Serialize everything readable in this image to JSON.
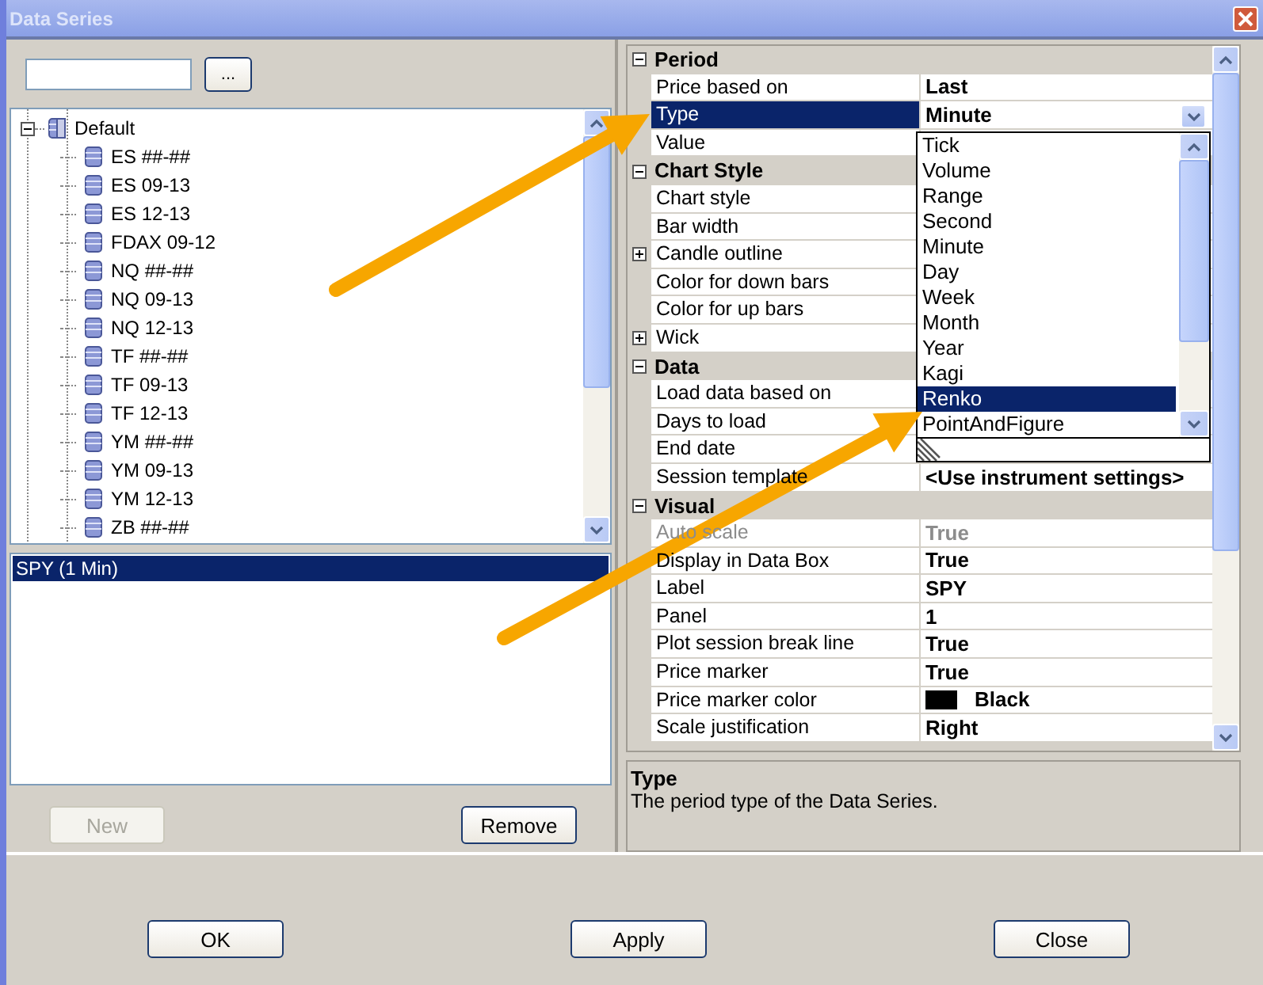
{
  "window": {
    "title": "Data Series"
  },
  "browse_button": "...",
  "tree": {
    "label": "Default",
    "expanded": true,
    "children": [
      {
        "label": "ES ##-##"
      },
      {
        "label": "ES 09-13"
      },
      {
        "label": "ES 12-13"
      },
      {
        "label": "FDAX 09-12"
      },
      {
        "label": "NQ ##-##"
      },
      {
        "label": "NQ 09-13"
      },
      {
        "label": "NQ 12-13"
      },
      {
        "label": "TF ##-##"
      },
      {
        "label": "TF 09-13"
      },
      {
        "label": "TF 12-13"
      },
      {
        "label": "YM ##-##"
      },
      {
        "label": "YM 09-13"
      },
      {
        "label": "YM 12-13"
      },
      {
        "label": "ZB ##-##"
      }
    ]
  },
  "series_list": [
    {
      "label": "SPY (1 Min)",
      "selected": true
    }
  ],
  "list_buttons": [
    {
      "label": "New",
      "disabled": true
    },
    {
      "label": "Remove",
      "disabled": false
    }
  ],
  "properties": [
    {
      "category": "Period",
      "expanded": true,
      "rows": [
        {
          "name": "Price based on",
          "value": "Last",
          "selected": false
        },
        {
          "name": "Type",
          "value": "Minute",
          "selected": true,
          "kind": "combo"
        },
        {
          "name": "Value",
          "selected": false
        }
      ]
    },
    {
      "category": "Chart Style",
      "expanded": true,
      "rows": [
        {
          "name": "Chart style",
          "selected": false
        },
        {
          "name": "Bar width",
          "selected": false
        },
        {
          "name": "Candle outline",
          "selected": false,
          "expanded": false
        },
        {
          "name": "Color for down bars",
          "selected": false
        },
        {
          "name": "Color for up bars",
          "selected": false
        },
        {
          "name": "Wick",
          "selected": false,
          "expanded": false
        }
      ]
    },
    {
      "category": "Data",
      "expanded": true,
      "rows": [
        {
          "name": "Load data based on",
          "selected": false
        },
        {
          "name": "Days to load",
          "selected": false
        },
        {
          "name": "End date",
          "selected": false
        },
        {
          "name": "Session template",
          "value": "<Use instrument settings>",
          "selected": false
        }
      ]
    },
    {
      "category": "Visual",
      "expanded": true,
      "rows": [
        {
          "name": "Auto scale",
          "value": "True",
          "selected": false,
          "disabled": true
        },
        {
          "name": "Display in Data Box",
          "value": "True",
          "selected": false
        },
        {
          "name": "Label",
          "value": "SPY",
          "selected": false
        },
        {
          "name": "Panel",
          "value": "1",
          "selected": false
        },
        {
          "name": "Plot session break line",
          "value": "True",
          "selected": false
        },
        {
          "name": "Price marker",
          "value": "True",
          "selected": false
        },
        {
          "name": "Price marker color",
          "value": "Black",
          "selected": false,
          "color": "#000000"
        },
        {
          "name": "Scale justification",
          "value": "Right",
          "selected": false
        }
      ]
    }
  ],
  "dropdown": {
    "items": [
      {
        "label": "Tick",
        "selected": false
      },
      {
        "label": "Volume",
        "selected": false
      },
      {
        "label": "Range",
        "selected": false
      },
      {
        "label": "Second",
        "selected": false
      },
      {
        "label": "Minute",
        "selected": false
      },
      {
        "label": "Day",
        "selected": false
      },
      {
        "label": "Week",
        "selected": false
      },
      {
        "label": "Month",
        "selected": false
      },
      {
        "label": "Year",
        "selected": false
      },
      {
        "label": "Kagi",
        "selected": false
      },
      {
        "label": "Renko",
        "selected": true
      },
      {
        "label": "PointAndFigure",
        "selected": false
      }
    ]
  },
  "description": {
    "title": "Type",
    "text": "The period type of the Data Series."
  },
  "dialog_buttons": [
    "OK",
    "Apply",
    "Close"
  ]
}
